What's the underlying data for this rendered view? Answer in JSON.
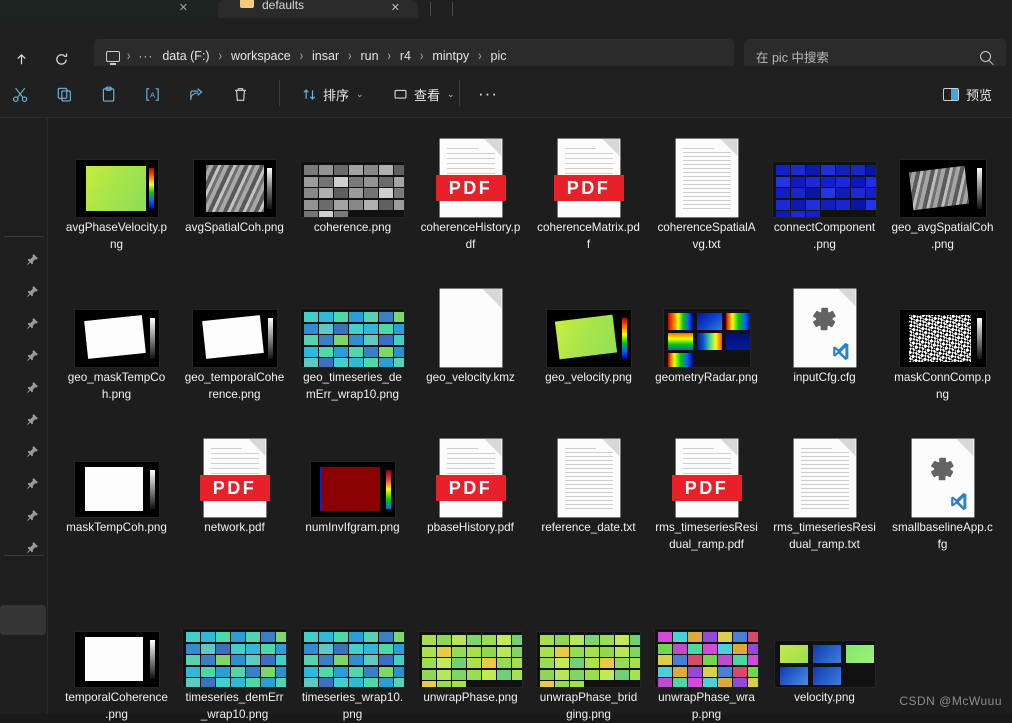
{
  "window": {
    "tabs": [
      {
        "label": "",
        "active": false
      },
      {
        "label": "defaults",
        "active": true
      }
    ]
  },
  "navbar": {
    "up_label": "↑",
    "refresh_label": "↻",
    "breadcrumbs": [
      "data (F:)",
      "workspace",
      "insar",
      "run",
      "r4",
      "mintpy",
      "pic"
    ],
    "overflow_label": "···",
    "separator": "›"
  },
  "search": {
    "placeholder": "在 pic 中搜索"
  },
  "toolbar": {
    "cut_label": "剪切",
    "copy_label": "复制",
    "paste_label": "粘贴",
    "rename_label": "重命名",
    "share_label": "共享",
    "delete_label": "删除",
    "sort_label": "排序",
    "view_label": "查看",
    "more_label": "···",
    "preview_label": "预览",
    "chevron": "⌄"
  },
  "navpane": {
    "pin_count": 10,
    "pin_icon": "pin-icon"
  },
  "files": [
    {
      "name": "avgPhaseVelocity.png",
      "type": "image",
      "thumb": "plot-velocity-green"
    },
    {
      "name": "avgSpatialCoh.png",
      "type": "image",
      "thumb": "plot-gray-coh"
    },
    {
      "name": "coherence.png",
      "type": "image",
      "thumb": "grid-gray"
    },
    {
      "name": "coherenceHistory.pdf",
      "type": "pdf",
      "thumb": "pdf-doc"
    },
    {
      "name": "coherenceMatrix.pdf",
      "type": "pdf",
      "thumb": "pdf-doc"
    },
    {
      "name": "coherenceSpatialAvg.txt",
      "type": "txt",
      "thumb": "text-doc"
    },
    {
      "name": "connectComponent.png",
      "type": "image",
      "thumb": "grid-blue"
    },
    {
      "name": "geo_avgSpatialCoh.png",
      "type": "image",
      "thumb": "plot-geo-gray"
    },
    {
      "name": "geo_maskTempCoh.png",
      "type": "image",
      "thumb": "plot-geo-white"
    },
    {
      "name": "geo_temporalCoherence.png",
      "type": "image",
      "thumb": "plot-geo-white"
    },
    {
      "name": "geo_timeseries_demErr_wrap10.png",
      "type": "image",
      "thumb": "grid-teal"
    },
    {
      "name": "geo_velocity.kmz",
      "type": "kmz",
      "thumb": "blank-doc"
    },
    {
      "name": "geo_velocity.png",
      "type": "image",
      "thumb": "plot-geo-green"
    },
    {
      "name": "geometryRadar.png",
      "type": "image",
      "thumb": "grid-rainbow"
    },
    {
      "name": "inputCfg.cfg",
      "type": "cfg",
      "thumb": "cfg-doc"
    },
    {
      "name": "maskConnComp.png",
      "type": "image",
      "thumb": "plot-bw-noise"
    },
    {
      "name": "maskTempCoh.png",
      "type": "image",
      "thumb": "plot-white"
    },
    {
      "name": "network.pdf",
      "type": "pdf",
      "thumb": "pdf-doc"
    },
    {
      "name": "numInvIfgram.png",
      "type": "image",
      "thumb": "plot-darkred"
    },
    {
      "name": "pbaseHistory.pdf",
      "type": "pdf",
      "thumb": "pdf-doc"
    },
    {
      "name": "reference_date.txt",
      "type": "txt",
      "thumb": "text-doc"
    },
    {
      "name": "rms_timeseriesResidual_ramp.pdf",
      "type": "pdf",
      "thumb": "pdf-doc"
    },
    {
      "name": "rms_timeseriesResidual_ramp.txt",
      "type": "txt",
      "thumb": "text-doc"
    },
    {
      "name": "smallbaselineApp.cfg",
      "type": "cfg",
      "thumb": "cfg-doc"
    },
    {
      "name": "temporalCoherence.png",
      "type": "image",
      "thumb": "plot-white"
    },
    {
      "name": "timeseries_demErr_wrap10.png",
      "type": "image",
      "thumb": "grid-teal"
    },
    {
      "name": "timeseries_wrap10.png",
      "type": "image",
      "thumb": "grid-teal"
    },
    {
      "name": "unwrapPhase.png",
      "type": "image",
      "thumb": "grid-green"
    },
    {
      "name": "unwrapPhase_bridging.png",
      "type": "image",
      "thumb": "grid-green"
    },
    {
      "name": "unwrapPhase_wrap.png",
      "type": "image",
      "thumb": "grid-magenta"
    },
    {
      "name": "velocity.png",
      "type": "image",
      "thumb": "grid-velocity"
    }
  ],
  "watermark": "CSDN @McWuuu",
  "colors": {
    "window_bg": "#202020",
    "content_bg": "#1d1d1d",
    "navpane_bg": "#1e1e1e",
    "accent": "#4aa3df",
    "pdf_red": "#e8202a",
    "text": "#f0f0f0"
  }
}
